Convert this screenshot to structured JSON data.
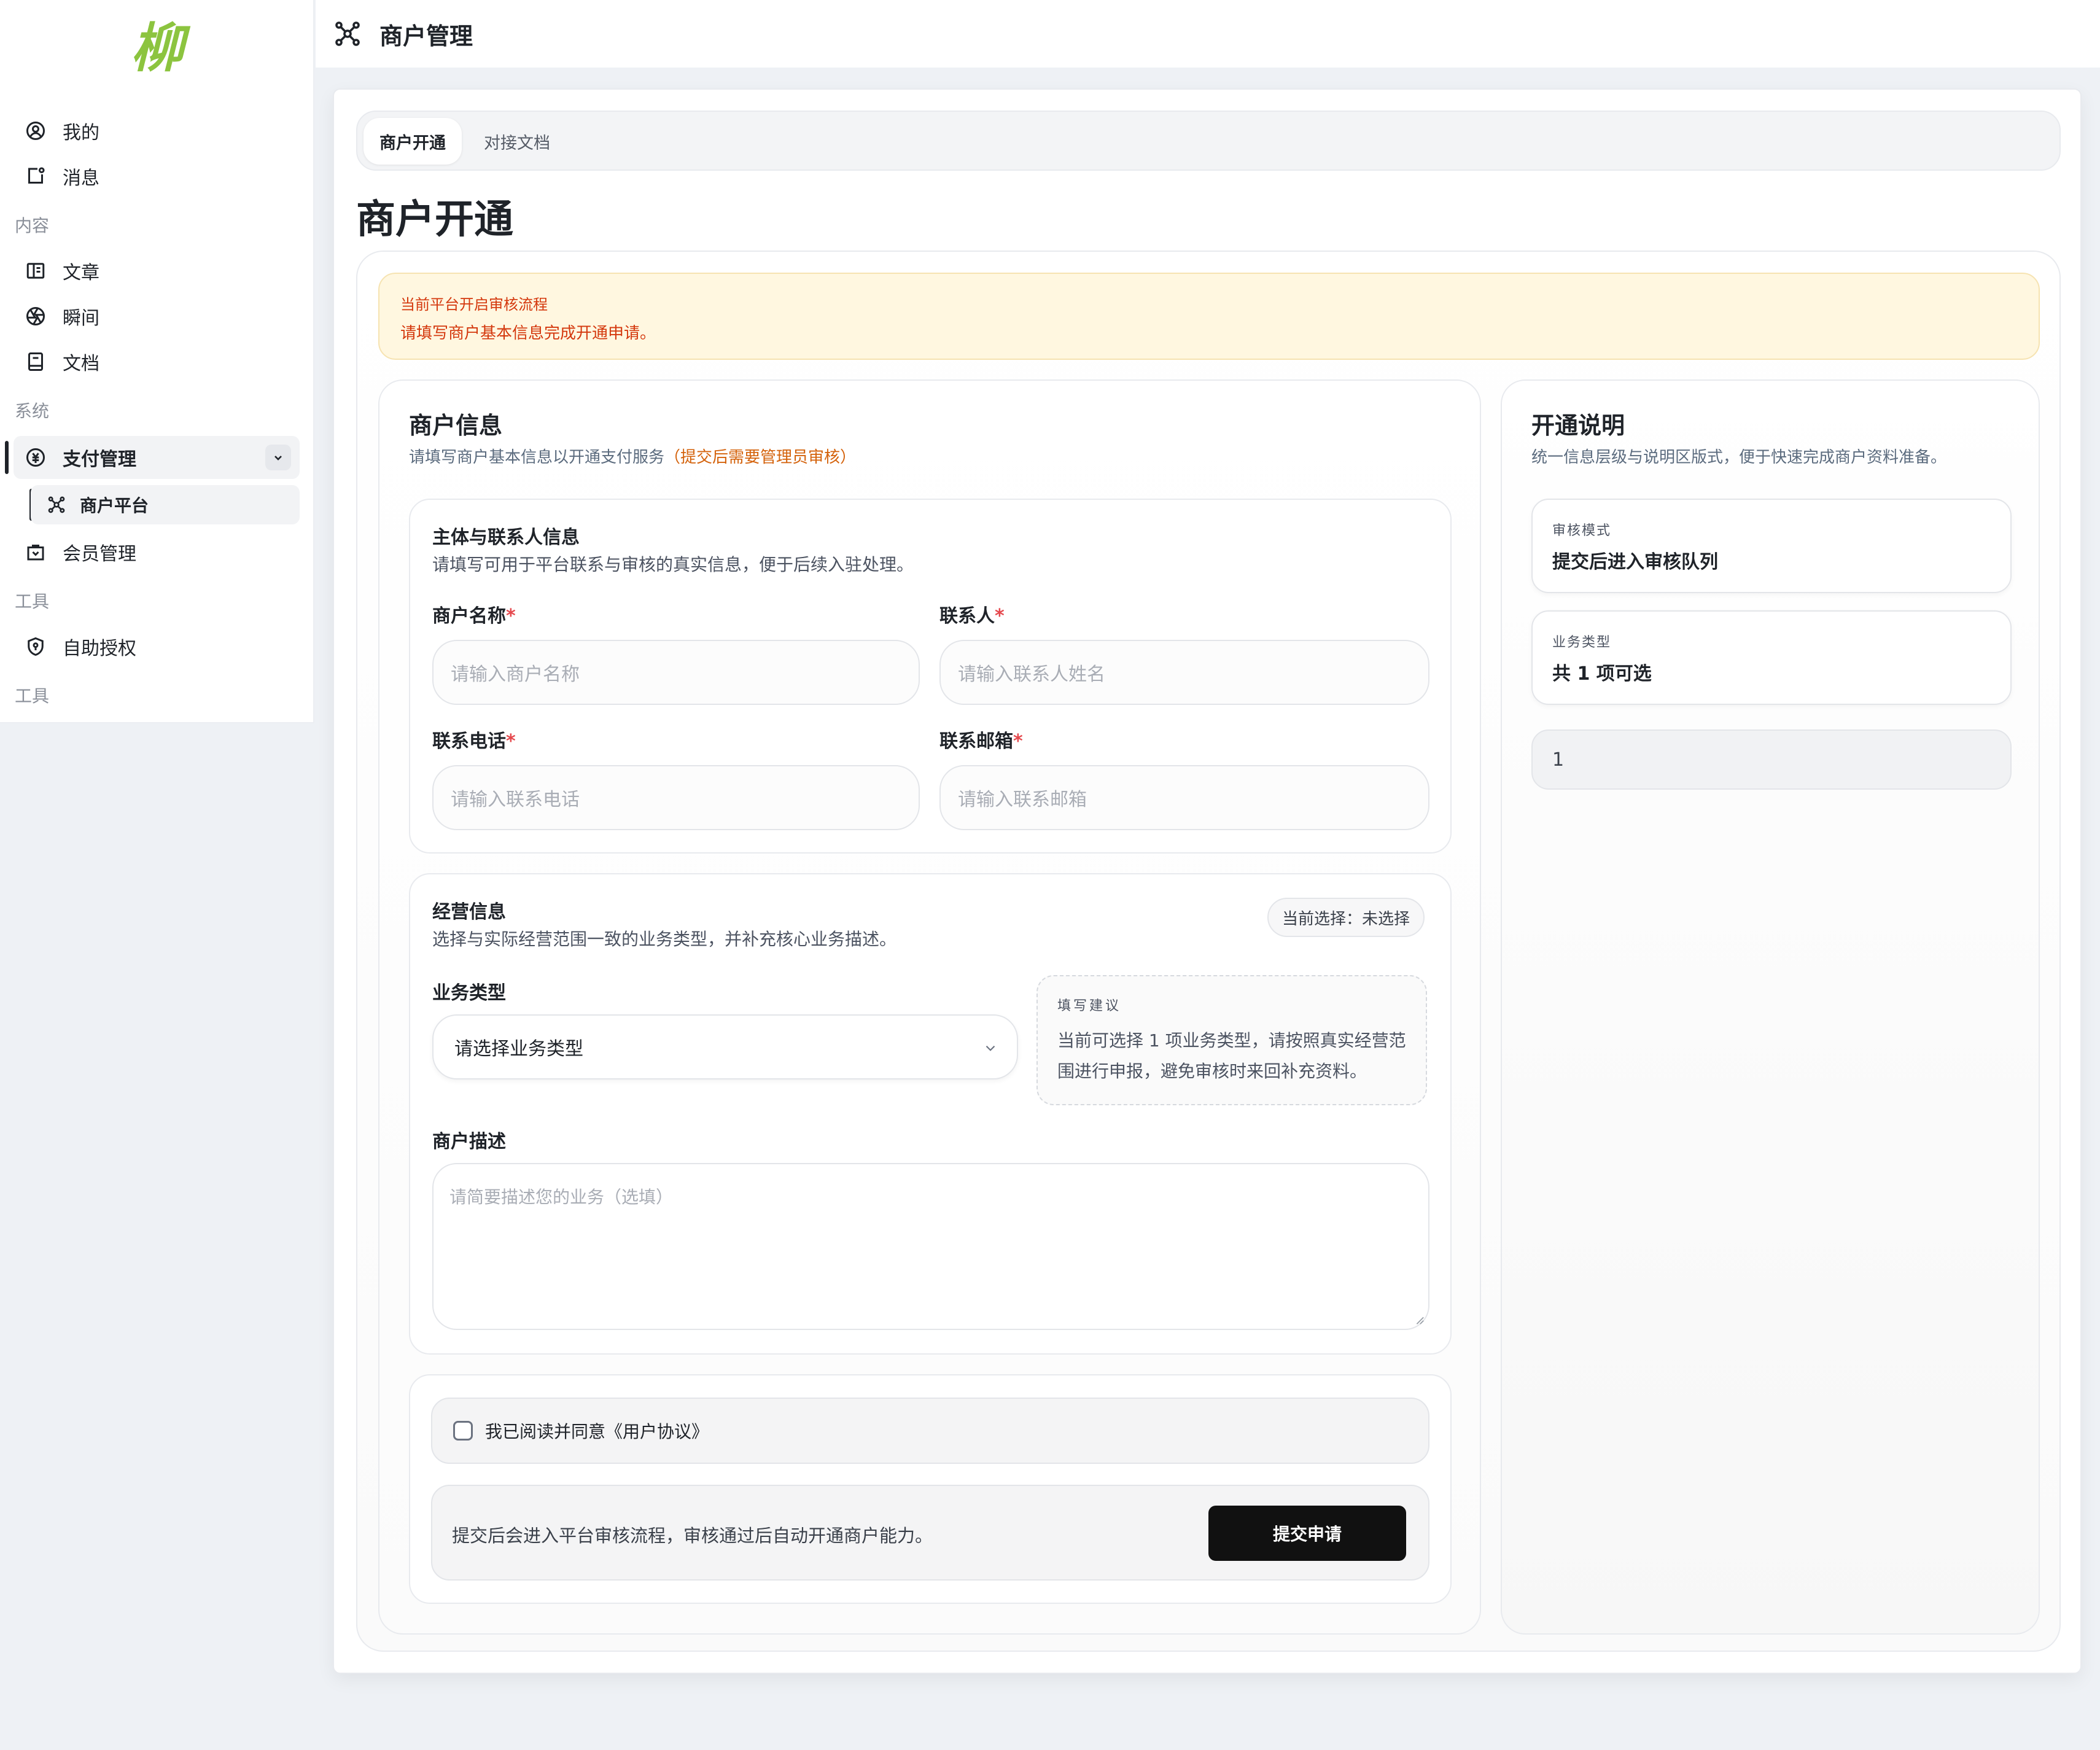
{
  "app": {
    "logo_text": "柳",
    "header_title": "商户管理"
  },
  "sidebar": {
    "items_top": [
      {
        "label": "我的",
        "icon": "user-circle-icon"
      },
      {
        "label": "消息",
        "icon": "message-icon"
      }
    ],
    "section_content": "内容",
    "items_content": [
      {
        "label": "文章",
        "icon": "book-open-icon"
      },
      {
        "label": "瞬间",
        "icon": "aperture-icon"
      },
      {
        "label": "文档",
        "icon": "document-icon"
      }
    ],
    "section_system": "系统",
    "pay_group": {
      "label": "支付管理",
      "icon": "currency-circle-icon",
      "expanded": true
    },
    "pay_sub": {
      "label": "商户平台",
      "icon": "network-icon"
    },
    "member": {
      "label": "会员管理",
      "icon": "shopping-bag-icon"
    },
    "section_tools": "工具",
    "authorize": {
      "label": "自助授权",
      "icon": "shield-icon"
    },
    "section_tools_2": "工具"
  },
  "tabs": [
    {
      "label": "商户开通",
      "active": true
    },
    {
      "label": "对接文档",
      "active": false
    }
  ],
  "page_title": "商户开通",
  "alert": {
    "line1": "当前平台开启审核流程",
    "line2": "请填写商户基本信息完成开通申请。"
  },
  "merchant_form": {
    "title": "商户信息",
    "subtitle": "请填写商户基本信息以开通支付服务",
    "subtitle_highlight": "（提交后需要管理员审核）",
    "contact_section": {
      "title": "主体与联系人信息",
      "desc": "请填写可用于平台联系与审核的真实信息，便于后续入驻处理。",
      "fields": {
        "name": {
          "label": "商户名称",
          "required_mark": "*",
          "placeholder": "请输入商户名称"
        },
        "contact": {
          "label": "联系人",
          "required_mark": "*",
          "placeholder": "请输入联系人姓名"
        },
        "phone": {
          "label": "联系电话",
          "required_mark": "*",
          "placeholder": "请输入联系电话"
        },
        "email": {
          "label": "联系邮箱",
          "required_mark": "*",
          "placeholder": "请输入联系邮箱"
        }
      }
    },
    "business_section": {
      "title": "经营信息",
      "desc": "选择与实际经营范围一致的业务类型，并补充核心业务描述。",
      "current_selection": "当前选择：未选择",
      "type_label": "业务类型",
      "type_selected": "请选择业务类型",
      "tip_title": "填写建议",
      "tip_body": "当前可选择 1 项业务类型，请按照真实经营范围进行申报，避免审核时来回补充资料。",
      "desc_label": "商户描述",
      "desc_placeholder": "请简要描述您的业务（选填）"
    },
    "agreement": {
      "label": "我已阅读并同意《用户协议》",
      "checked": false
    },
    "submit": {
      "note": "提交后会进入平台审核流程，审核通过后自动开通商户能力。",
      "button": "提交申请"
    }
  },
  "info_panel": {
    "title": "开通说明",
    "subtitle": "统一信息层级与说明区版式，便于快速完成商户资料准备。",
    "review_mode": {
      "key": "审核模式",
      "value": "提交后进入审核队列"
    },
    "business_type": {
      "key": "业务类型",
      "value": "共 1 项可选"
    },
    "option_value": "1"
  },
  "colors": {
    "accent": "#111111",
    "alert_bg": "#fff7e0",
    "alert_text": "#d4380d",
    "highlight": "#d4620b",
    "required": "#e5484d",
    "logo": "#8cc43f"
  }
}
